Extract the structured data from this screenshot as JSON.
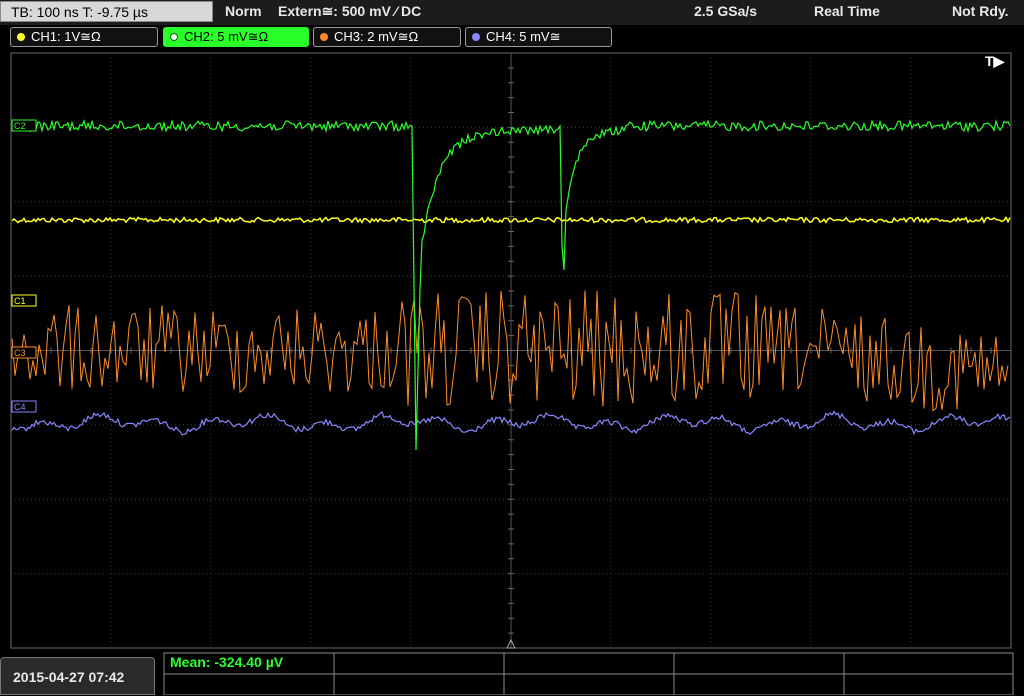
{
  "topbar": {
    "timebase": "TB: 100 ns   T: -9.75 µs",
    "trigger_mode": "Norm",
    "trigger_source": "Extern≅: 500 mV ⁄ DC",
    "sample_rate": "2.5 GSa/s",
    "acq_mode": "Real Time",
    "status": "Not Rdy."
  },
  "channels": [
    {
      "label": "CH1: 1V≅Ω",
      "color": "#ffff2a",
      "active": false
    },
    {
      "label": "CH2: 5 mV≅Ω",
      "color": "#2bff2b",
      "active": true
    },
    {
      "label": "CH3: 2 mV≅Ω",
      "color": "#ff8c2a",
      "active": false
    },
    {
      "label": "CH4: 5 mV≅",
      "color": "#8888ff",
      "active": false
    }
  ],
  "screen": {
    "trigger_marker": "T▶",
    "markers": [
      {
        "label": "C2",
        "color": "#2bff2b"
      },
      {
        "label": "C1",
        "color": "#ffff2a"
      },
      {
        "label": "C3",
        "color": "#ff8c2a"
      },
      {
        "label": "C4",
        "color": "#8888ff"
      }
    ]
  },
  "footer": {
    "datetime": "2015-04-27 07:42",
    "mean_label": "Mean: -324.40 µV"
  }
}
